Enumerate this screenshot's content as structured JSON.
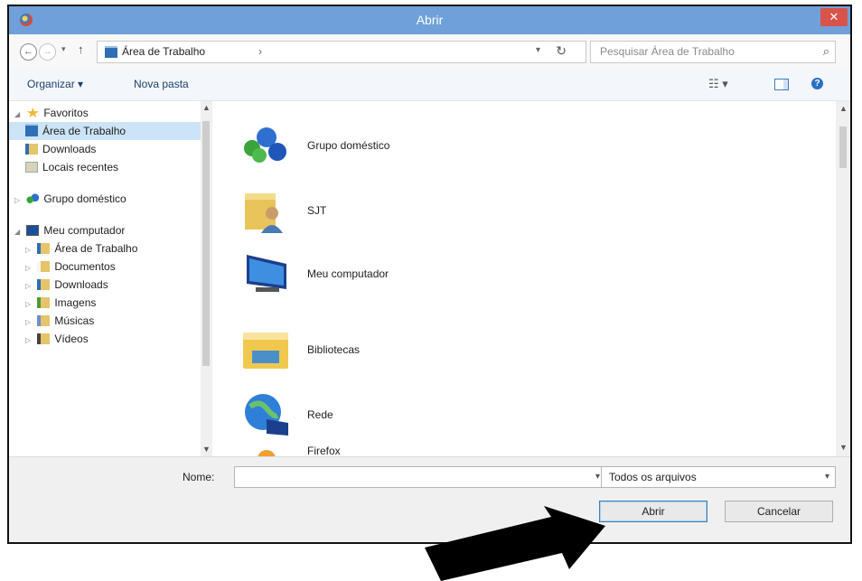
{
  "window": {
    "title": "Abrir",
    "close_symbol": "✕"
  },
  "nav": {
    "back_symbol": "←",
    "forward_symbol": "→",
    "recent_symbol": "▾",
    "up_symbol": "↑",
    "address": "Área de Trabalho",
    "address_chevron": "›",
    "address_dropdown_symbol": "▾",
    "refresh_symbol": "↻",
    "search_placeholder": "Pesquisar Área de Trabalho",
    "search_symbol": "⌕"
  },
  "toolbar": {
    "organize_label": "Organizar ▾",
    "new_folder_label": "Nova pasta",
    "view_symbol": "☷ ▾",
    "help_symbol": "?"
  },
  "sidebar": {
    "favorites": "Favoritos",
    "fav_desktop": "Área de Trabalho",
    "fav_downloads": "Downloads",
    "fav_recent": "Locais recentes",
    "homegroup": "Grupo doméstico",
    "computer": "Meu computador",
    "pc_desktop": "Área de Trabalho",
    "pc_documents": "Documentos",
    "pc_downloads": "Downloads",
    "pc_images": "Imagens",
    "pc_music": "Músicas",
    "pc_videos": "Vídeos",
    "expanded_symbol": "◢",
    "collapsed_symbol": "▷"
  },
  "files": {
    "item1": "Grupo doméstico",
    "item2": "SJT",
    "item3": "Meu computador",
    "item4": "Bibliotecas",
    "item5": "Rede",
    "item6": "Firefox"
  },
  "footer": {
    "name_label": "Nome:",
    "name_value": "",
    "name_dropdown_symbol": "▾",
    "filter_value": "Todos os arquivos",
    "filter_dropdown_symbol": "▾",
    "open_label": "Abrir",
    "cancel_label": "Cancelar"
  },
  "scroll": {
    "up_symbol": "▲",
    "down_symbol": "▼"
  },
  "colors": {
    "titlebar": "#6fa0d9",
    "close": "#d9534a",
    "selection": "#cce4f7",
    "arrow": "#000000"
  }
}
